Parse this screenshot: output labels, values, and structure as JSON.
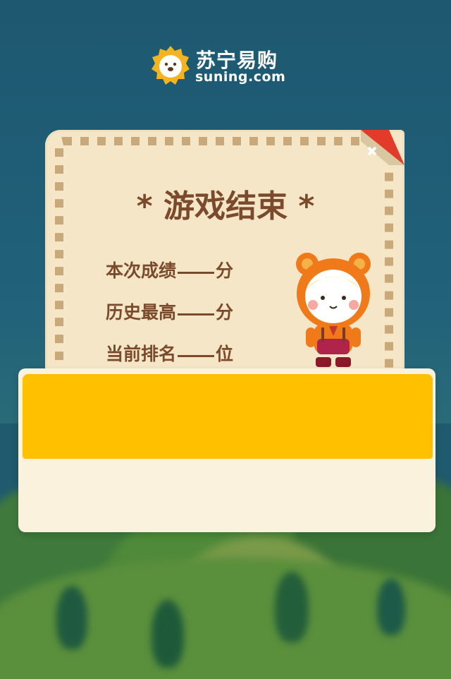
{
  "brand": {
    "name_cn": "苏宁易购",
    "name_en": "suning.com",
    "color": "#f5b320"
  },
  "dialog": {
    "title": "* 游戏结束 *",
    "close_icon": "close-icon",
    "rows": [
      {
        "prefix": "本次成绩",
        "suffix": "分"
      },
      {
        "prefix": "历史最高",
        "suffix": "分"
      },
      {
        "prefix": "当前排名",
        "suffix": "位"
      }
    ]
  },
  "colors": {
    "card_bg": "#f4e6c6",
    "text_brown": "#7b4a2c",
    "close_red": "#e23b2a",
    "panel_yellow": "#ffc000"
  }
}
